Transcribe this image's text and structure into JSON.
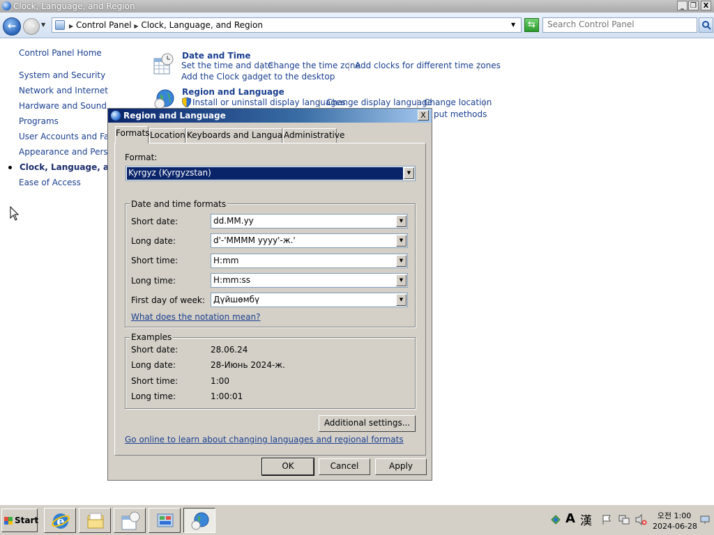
{
  "window": {
    "title": "Clock, Language, and Region",
    "controls": {
      "minimize": "_",
      "maximize": "❐",
      "close": "X"
    }
  },
  "address": {
    "crumbs": [
      "Control Panel",
      "Clock, Language, and Region"
    ],
    "search_placeholder": "Search Control Panel"
  },
  "left_nav": {
    "items": [
      "Control Panel Home",
      "System and Security",
      "Network and Internet",
      "Hardware and Sound",
      "Programs",
      "User Accounts and Family",
      "Appearance and Personali",
      "Clock, Language, and R",
      "Ease of Access"
    ]
  },
  "categories": [
    {
      "title": "Date and Time",
      "icon": "calendar-clock-icon",
      "links": [
        "Set the time and date",
        "Change the time zone",
        "Add clocks for different time zones",
        "Add the Clock gadget to the desktop"
      ]
    },
    {
      "title": "Region and Language",
      "icon": "globe-clock-icon",
      "links": [
        "Install or uninstall display languages",
        "Change display language",
        "Change location",
        "put methods"
      ]
    }
  ],
  "dialog": {
    "title": "Region and Language",
    "close": "X",
    "tabs": [
      "Formats",
      "Location",
      "Keyboards and Languages",
      "Administrative"
    ],
    "format_label": "Format:",
    "format_value": "Kyrgyz (Kyrgyzstan)",
    "dt_group_label": "Date and time formats",
    "fields": [
      {
        "label": "Short date:",
        "value": "dd.MM.yy"
      },
      {
        "label": "Long date:",
        "value": "d'-'MMMM yyyy'-ж.'"
      },
      {
        "label": "Short time:",
        "value": "H:mm"
      },
      {
        "label": "Long time:",
        "value": "H:mm:ss"
      },
      {
        "label": "First day of week:",
        "value": "Дүйшөмбү"
      }
    ],
    "notation_link": "What does the notation mean?",
    "examples_label": "Examples",
    "examples": [
      {
        "label": "Short date:",
        "value": "28.06.24"
      },
      {
        "label": "Long date:",
        "value": "28-Июнь 2024-ж."
      },
      {
        "label": "Short time:",
        "value": "1:00"
      },
      {
        "label": "Long time:",
        "value": "1:00:01"
      }
    ],
    "additional_settings": "Additional settings...",
    "online_link": "Go online to learn about changing languages and regional formats",
    "buttons": {
      "ok": "OK",
      "cancel": "Cancel",
      "apply": "Apply"
    }
  },
  "taskbar": {
    "start": "Start",
    "ime_a": "A",
    "ime_han": "漢",
    "clock_time": "오전 1:00",
    "clock_date": "2024-06-28"
  }
}
